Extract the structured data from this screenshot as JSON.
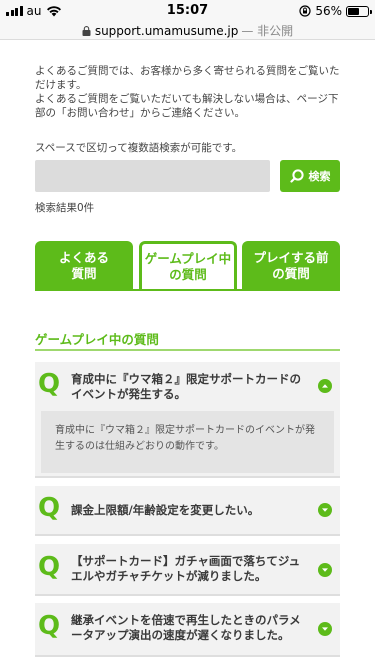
{
  "status": {
    "carrier": "au",
    "time": "15:07",
    "battery": "56%",
    "battery_level": 0.56
  },
  "browser": {
    "url": "support.umamusume.jp",
    "url_suffix": "— 非公開"
  },
  "intro": {
    "line1": "よくあるご質問では、お客様から多く寄せられる質問をご覧いただけます。",
    "line2": "よくあるご質問をご覧いただいても解決しない場合は、ページ下部の「お問い合わせ」からご連絡ください。"
  },
  "search": {
    "hint": "スペースで区切って複数語検索が可能です。",
    "placeholder": "",
    "button_label": "検索",
    "result_count": "検索結果0件"
  },
  "tabs": [
    {
      "label": "よくある\n質問"
    },
    {
      "label": "ゲームプレイ中\nの質問"
    },
    {
      "label": "プレイする前\nの質問"
    }
  ],
  "section": {
    "title": "ゲームプレイ中の質問"
  },
  "faqs": [
    {
      "mark": "Q",
      "question": "育成中に『ウマ箱２』限定サポートカードのイベントが発生する。",
      "expanded": true,
      "answer": "育成中に『ウマ箱２』限定サポートカードのイベントが発生するのは仕組みどおりの動作です。"
    },
    {
      "mark": "Q",
      "question": "課金上限額/年齢設定を変更したい。",
      "expanded": false
    },
    {
      "mark": "Q",
      "question": "【サポートカード】ガチャ画面で落ちてジュエルやガチャチケットが減りました。",
      "expanded": false
    },
    {
      "mark": "Q",
      "question": "継承イベントを倍速で再生したときのパラメータアップ演出の速度が遅くなりました。",
      "expanded": false
    }
  ],
  "colors": {
    "accent": "#5dbb1a",
    "panel": "#f2f2f2"
  }
}
